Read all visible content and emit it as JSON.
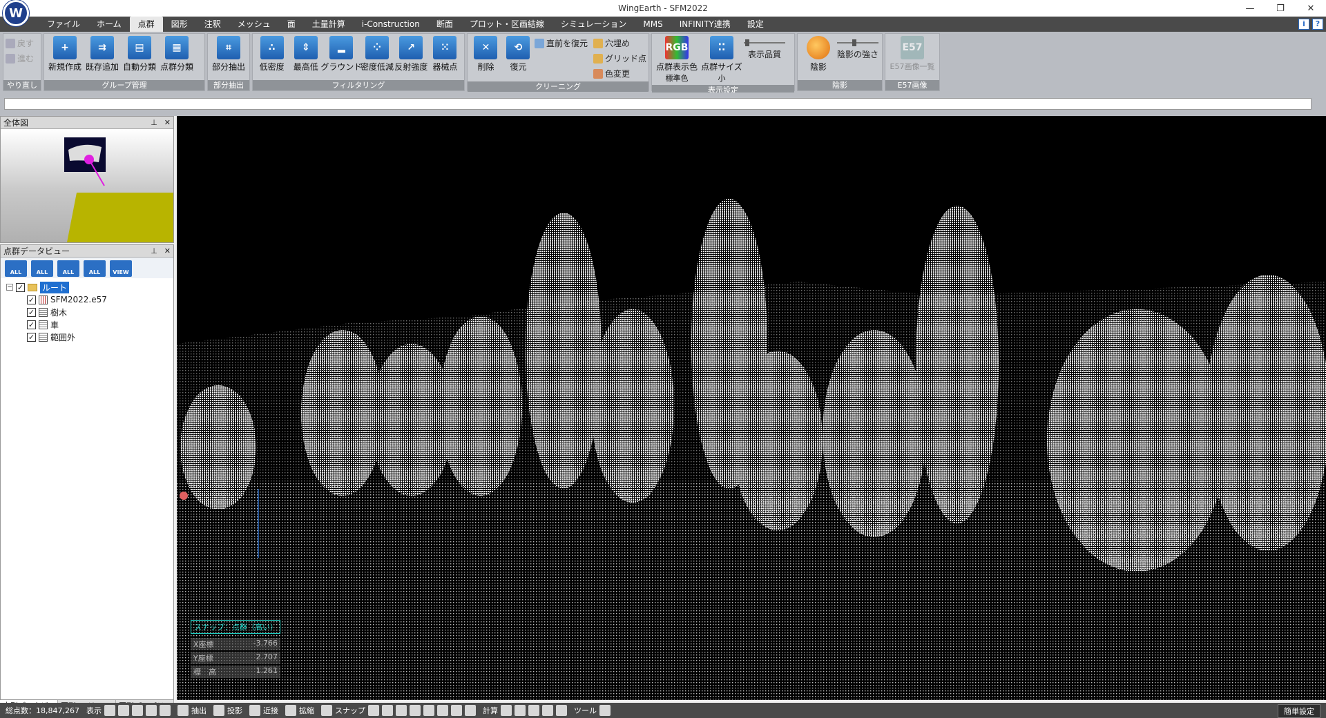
{
  "window": {
    "title": "WingEarth - SFM2022",
    "controls": [
      "—",
      "❐",
      "✕"
    ]
  },
  "menu": {
    "tabs": [
      "ファイル",
      "ホーム",
      "点群",
      "図形",
      "注釈",
      "メッシュ",
      "面",
      "土量計算",
      "i-Construction",
      "断面",
      "プロット・区画結線",
      "シミュレーション",
      "MMS",
      "INFINITY連携",
      "設定"
    ],
    "active": "点群",
    "right_icons": [
      "info-icon",
      "help-icon"
    ]
  },
  "ribbon": {
    "undo": {
      "label": "やり直し",
      "undo": "戻す",
      "redo": "進む"
    },
    "group_mgmt": {
      "label": "グループ管理",
      "new": "新規作成",
      "add_existing": "既存追加",
      "auto_classify": "自動分類",
      "classify": "点群分類"
    },
    "partial": {
      "label": "部分抽出",
      "extract": "部分抽出"
    },
    "filtering": {
      "label": "フィルタリング",
      "low_density": "低密度",
      "lowest_high": "最高低",
      "ground": "グラウンド",
      "density_reduce": "密度低減",
      "reflectance": "反射強度",
      "machine_points": "器械点"
    },
    "cleaning": {
      "label": "クリーニング",
      "delete": "削除",
      "restore": "復元",
      "restore_prev": "直前を復元",
      "fill_holes": "穴埋め",
      "grid_points": "グリッド点",
      "color_change": "色変更"
    },
    "display": {
      "label": "表示設定",
      "color": "点群表示色",
      "color_val": "標準色",
      "size": "点群サイズ",
      "size_val": "小",
      "quality": "表示品質"
    },
    "shading": {
      "label": "陰影",
      "shade": "陰影",
      "strength": "陰影の強さ"
    },
    "e57": {
      "label": "E57画像",
      "list": "E57画像一覧"
    }
  },
  "overview": {
    "title": "全体図"
  },
  "dataview": {
    "title": "点群データビュー",
    "toolbar": [
      "ALL",
      "ALL",
      "ALL",
      "ALL",
      "VIEW"
    ],
    "root": "ルート",
    "items": [
      "SFM2022.e57",
      "樹木",
      "車",
      "範囲外"
    ]
  },
  "bottom_tabs": [
    "点群データビ..",
    "図形レイヤ...",
    "図形プロパテ..."
  ],
  "hud": {
    "snap": "スナップ：点群（高い）",
    "x_label": "X座標",
    "x_value": "-3.766",
    "y_label": "Y座標",
    "y_value": "2.707",
    "z_label": "標　高",
    "z_value": "1.261"
  },
  "status": {
    "total": "総点数：18,847,267",
    "display": "表示",
    "extract": "抽出",
    "projection": "投影",
    "near": "近接",
    "zoom": "拡縮",
    "snap": "スナップ",
    "calc": "計算",
    "tools": "ツール",
    "easy": "簡単設定"
  }
}
